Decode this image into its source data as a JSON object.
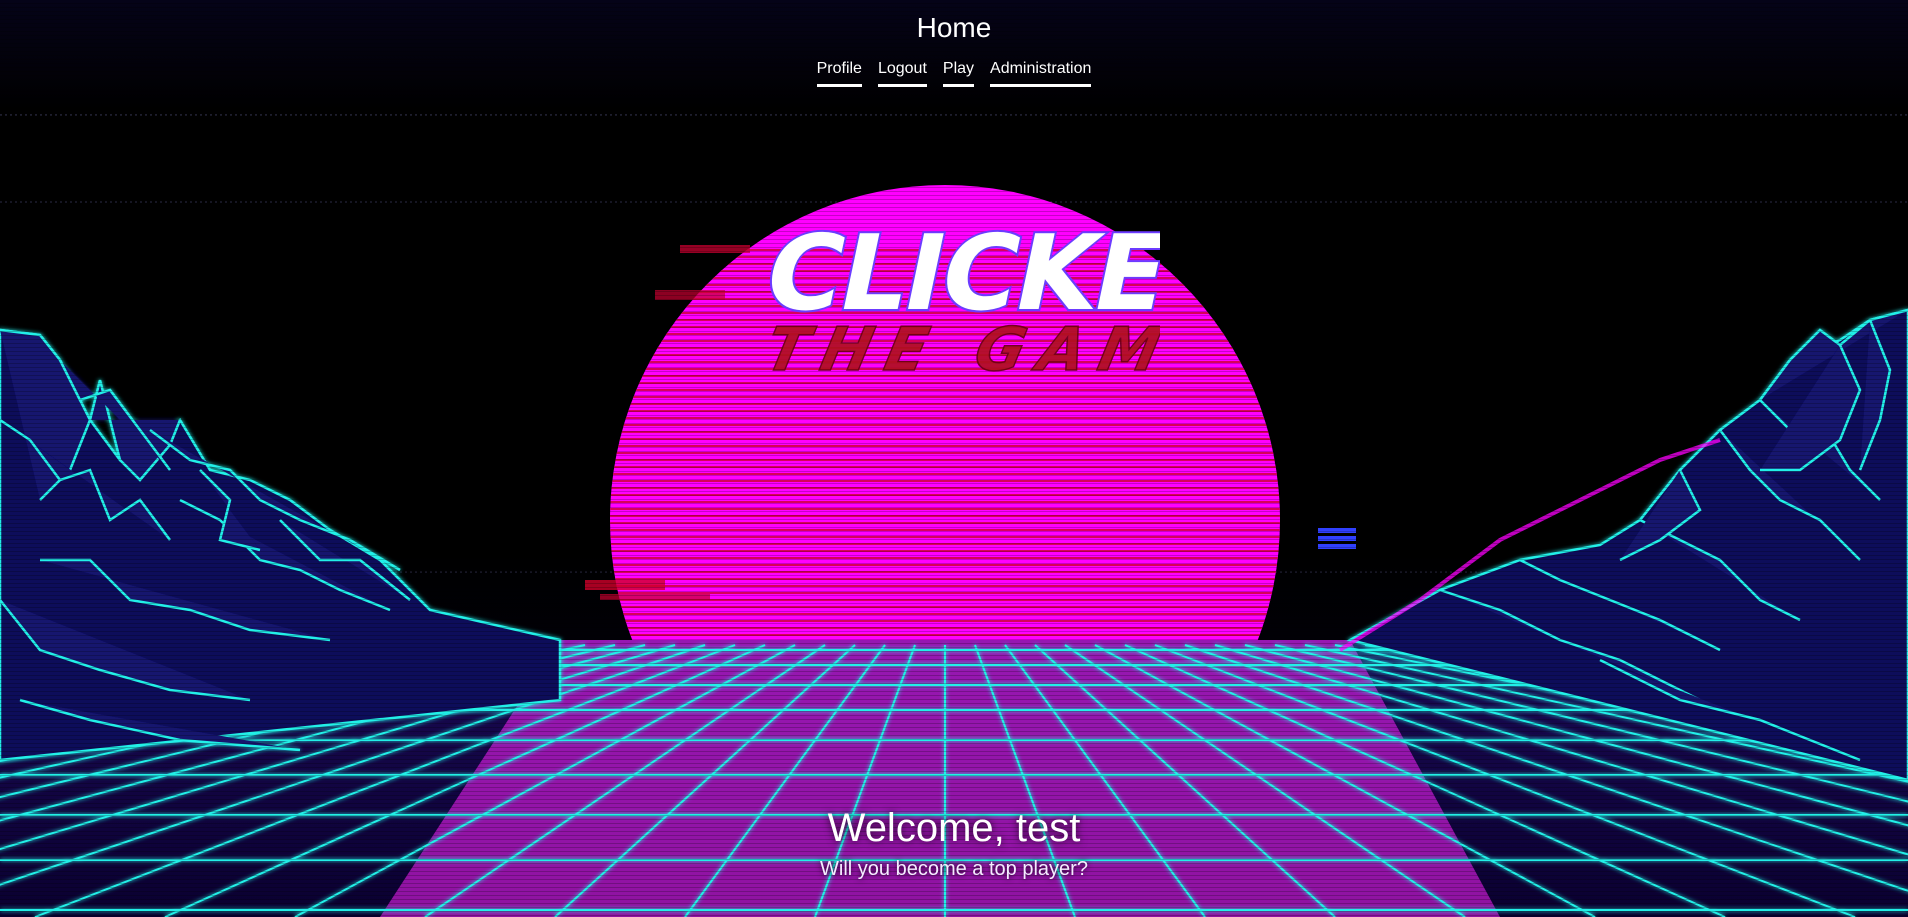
{
  "header": {
    "title": "Home",
    "nav": [
      {
        "label": "Profile"
      },
      {
        "label": "Logout"
      },
      {
        "label": "Play"
      },
      {
        "label": "Administration"
      }
    ]
  },
  "logo": {
    "line1": "CLICKER",
    "line2": "THE GAME"
  },
  "welcome": {
    "heading": "Welcome, test",
    "subtitle": "Will you become a top player?"
  },
  "colors": {
    "sun": "#ff00ff",
    "grid": "#22f0e8",
    "logo_outline": "#6c3bff",
    "logo_sub": "#b01020"
  }
}
